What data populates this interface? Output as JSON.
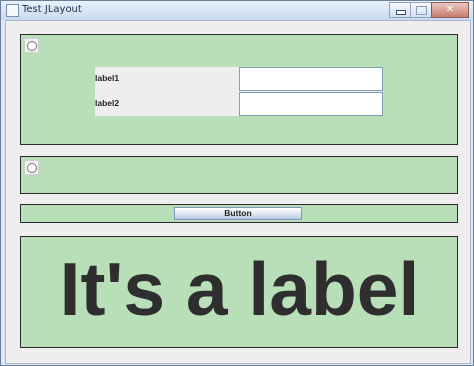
{
  "window": {
    "title": "Test JLayout"
  },
  "form": {
    "label1": "label1",
    "label2": "label2",
    "field1_value": "",
    "field2_value": ""
  },
  "button": {
    "label": "Button"
  },
  "big_label": {
    "text": "It's a label"
  },
  "colors": {
    "panel": "#b8dfb8",
    "panel_border": "#2b2b2b",
    "window_bg": "#dfe9f5"
  }
}
